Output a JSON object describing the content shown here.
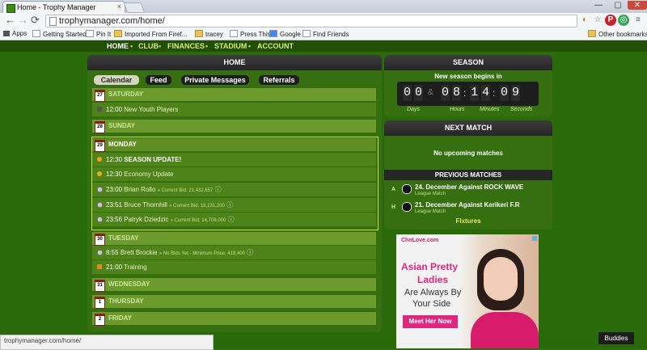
{
  "browser": {
    "tab_title": "Home - Trophy Manager",
    "tab_close": "×",
    "url": "trophymanager.com/home/",
    "back": "←",
    "forward": "→",
    "reload": "⟳",
    "bookmarks": [
      "Apps",
      "Getting Started",
      "Pin It",
      "Imported From Firef...",
      "tracey",
      "Press This",
      "Google",
      "Find Friends"
    ],
    "other_bookmarks": "Other bookmarks",
    "status_url": "trophymanager.com/home/"
  },
  "nav": {
    "home": "HOME",
    "club": "CLUB",
    "finances": "FINANCES",
    "stadium": "STADIUM",
    "account": "ACCOUNT",
    "sep": "•"
  },
  "home_panel": {
    "title": "HOME",
    "tabs": [
      "Calendar",
      "Feed",
      "Private Messages",
      "Referrals"
    ],
    "days": [
      {
        "num": "27",
        "label": "SATURDAY"
      },
      {
        "num": "28",
        "label": "SUNDAY"
      },
      {
        "num": "29",
        "label": "MONDAY"
      },
      {
        "num": "30",
        "label": "TUESDAY"
      },
      {
        "num": "31",
        "label": "WEDNESDAY"
      },
      {
        "num": "1",
        "label": "THURSDAY"
      },
      {
        "num": "2",
        "label": "FRIDAY"
      }
    ],
    "events": {
      "sat1": {
        "time": "12:00",
        "text": "New Youth Players"
      },
      "mon1": {
        "time": "12:30",
        "text": "SEASON UPDATE!"
      },
      "mon2": {
        "time": "12:30",
        "text": "Economy Update"
      },
      "mon3": {
        "time": "23:00",
        "text": "Brian Rollo",
        "bid": "» Current Bid: 21,432,657"
      },
      "mon4": {
        "time": "23:51",
        "text": "Bruce Thornhill",
        "bid": "» Current Bid: 18,131,200"
      },
      "mon5": {
        "time": "23:56",
        "text": "Patryk Dziedzic",
        "bid": "» Current Bid: 14,706,000"
      },
      "tue1": {
        "time": "8:55",
        "text": "Brett Brockie",
        "bid": "» No Bids Yet - Minimum Price: 418,400"
      },
      "tue2": {
        "time": "21:00",
        "text": "Training"
      }
    }
  },
  "season": {
    "title": "SEASON",
    "subtitle": "New season begins in",
    "digits": [
      "0",
      "0",
      "0",
      "8",
      "1",
      "4",
      "0",
      "9"
    ],
    "amp": "&",
    "colon": ":",
    "units": [
      "Days",
      "Hours",
      "Minutes",
      "Seconds"
    ]
  },
  "next_match": {
    "title": "NEXT MATCH",
    "empty": "No upcoming matches",
    "previous_title": "PREVIOUS MATCHES",
    "matches": [
      {
        "side": "A",
        "text": "24. December Against ROCK WAVE",
        "sub": "League Match"
      },
      {
        "side": "H",
        "text": "21. December Against Kerikeri F.R",
        "sub": "League Match"
      }
    ],
    "fixtures": "Fixtures"
  },
  "ad": {
    "brand": "ChnLove.com",
    "headline1": "Asian Pretty",
    "headline2": "Ladies",
    "line1": "Are Always By",
    "line2": "Your Side",
    "cta": "Meet Her Now"
  },
  "buddies": "Buddies"
}
